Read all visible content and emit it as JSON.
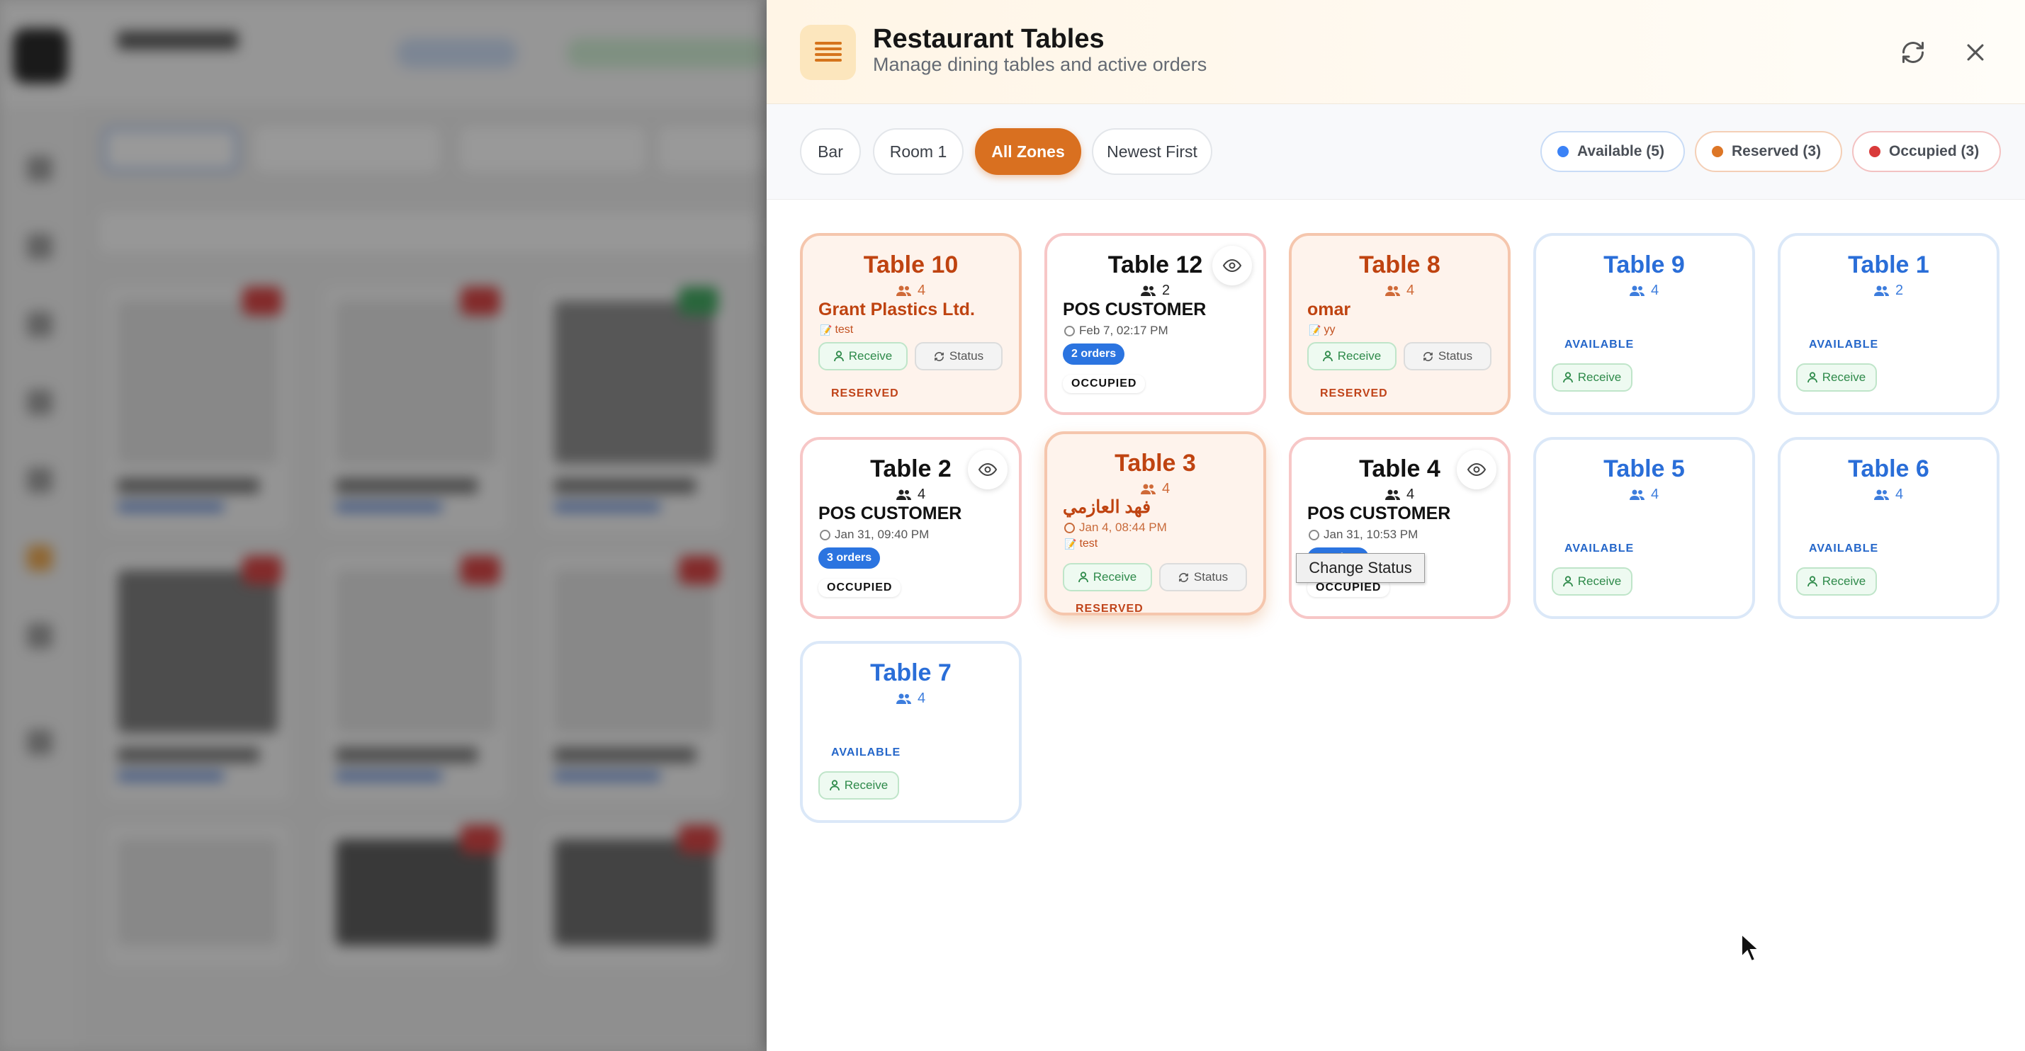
{
  "panel": {
    "title": "Restaurant Tables",
    "subtitle": "Manage dining tables and active orders",
    "menu_icon": "list-icon",
    "refresh_icon": "refresh-icon",
    "close_icon": "close-icon"
  },
  "filters": {
    "zones": [
      {
        "label": "Bar",
        "active": false
      },
      {
        "label": "Room 1",
        "active": false
      },
      {
        "label": "All Zones",
        "active": true
      },
      {
        "label": "Newest First",
        "active": false
      }
    ],
    "legend": [
      {
        "label": "Available (5)",
        "color": "#3b82f6",
        "border": "#c9dcf6"
      },
      {
        "label": "Reserved (3)",
        "color": "#dd7626",
        "border": "#f4cfb6"
      },
      {
        "label": "Occupied (3)",
        "color": "#d93a3a",
        "border": "#f3c2c2"
      }
    ]
  },
  "tables": [
    {
      "name": "Table 10",
      "seats": "4",
      "status": "reserved",
      "customer": "Grant Plastics Ltd.",
      "note": "test",
      "status_label": "RESERVED",
      "receive_label": "Receive",
      "status_btn_label": "Status"
    },
    {
      "name": "Table 12",
      "seats": "2",
      "status": "occupied",
      "customer": "POS CUSTOMER",
      "time": "Feb 7, 02:17 PM",
      "orders": "2 orders",
      "status_label": "OCCUPIED"
    },
    {
      "name": "Table 8",
      "seats": "4",
      "status": "reserved",
      "customer": "omar",
      "note": "yy",
      "status_label": "RESERVED",
      "receive_label": "Receive",
      "status_btn_label": "Status"
    },
    {
      "name": "Table 9",
      "seats": "4",
      "status": "available",
      "status_label": "AVAILABLE",
      "receive_label": "Receive"
    },
    {
      "name": "Table 1",
      "seats": "2",
      "status": "available",
      "status_label": "AVAILABLE",
      "receive_label": "Receive"
    },
    {
      "name": "Table 2",
      "seats": "4",
      "status": "occupied",
      "customer": "POS CUSTOMER",
      "time": "Jan 31, 09:40 PM",
      "orders": "3 orders",
      "status_label": "OCCUPIED"
    },
    {
      "name": "Table 3",
      "seats": "4",
      "status": "reserved",
      "customer": "فهد العازمي",
      "time": "Jan 4, 08:44 PM",
      "note": "test",
      "status_label": "RESERVED",
      "receive_label": "Receive",
      "status_btn_label": "Status"
    },
    {
      "name": "Table 4",
      "seats": "4",
      "status": "occupied",
      "customer": "POS CUSTOMER",
      "time": "Jan 31, 10:53 PM",
      "orders": "5 orders",
      "status_label": "OCCUPIED"
    },
    {
      "name": "Table 5",
      "seats": "4",
      "status": "available",
      "status_label": "AVAILABLE",
      "receive_label": "Receive"
    },
    {
      "name": "Table 6",
      "seats": "4",
      "status": "available",
      "status_label": "AVAILABLE",
      "receive_label": "Receive"
    },
    {
      "name": "Table 7",
      "seats": "4",
      "status": "available",
      "status_label": "AVAILABLE",
      "receive_label": "Receive"
    }
  ],
  "tooltip": "Change Status"
}
